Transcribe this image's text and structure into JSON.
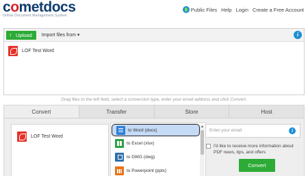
{
  "brand": {
    "name": "cometdocs",
    "tagline": "Online Document Management System",
    "colors": {
      "primary": "#0f3d6e",
      "accent": "#d8232a",
      "green": "#2dab36",
      "info": "#1e8fd6"
    }
  },
  "topnav": {
    "public_files": "Public Files",
    "help": "Help",
    "login": "Login",
    "create_account": "Create a Free Account"
  },
  "upload": {
    "button_label": "Upload",
    "import_label": "Import files from ▾",
    "file_name": "LOF Test Word"
  },
  "drag_hint": "Drag files to the left field, select a conversion type, enter your email address and click Convert.",
  "tabs": [
    "Convert",
    "Transfer",
    "Store",
    "Host"
  ],
  "convert": {
    "file_name": "LOF Test Word",
    "formats": [
      {
        "label": "to Word (docx)",
        "icon": "word-icon",
        "selected": true
      },
      {
        "label": "to Excel (xlsx)",
        "icon": "excel-icon",
        "selected": false
      },
      {
        "label": "to DWG (dwg)",
        "icon": "dwg-icon",
        "selected": false
      },
      {
        "label": "to Powerpoint (pptx)",
        "icon": "powerpoint-icon",
        "selected": false
      }
    ],
    "email_placeholder": "Enter your email",
    "optin_text": "I'd like to receive more information about PDF news, tips, and offers",
    "convert_label": "Convert"
  }
}
